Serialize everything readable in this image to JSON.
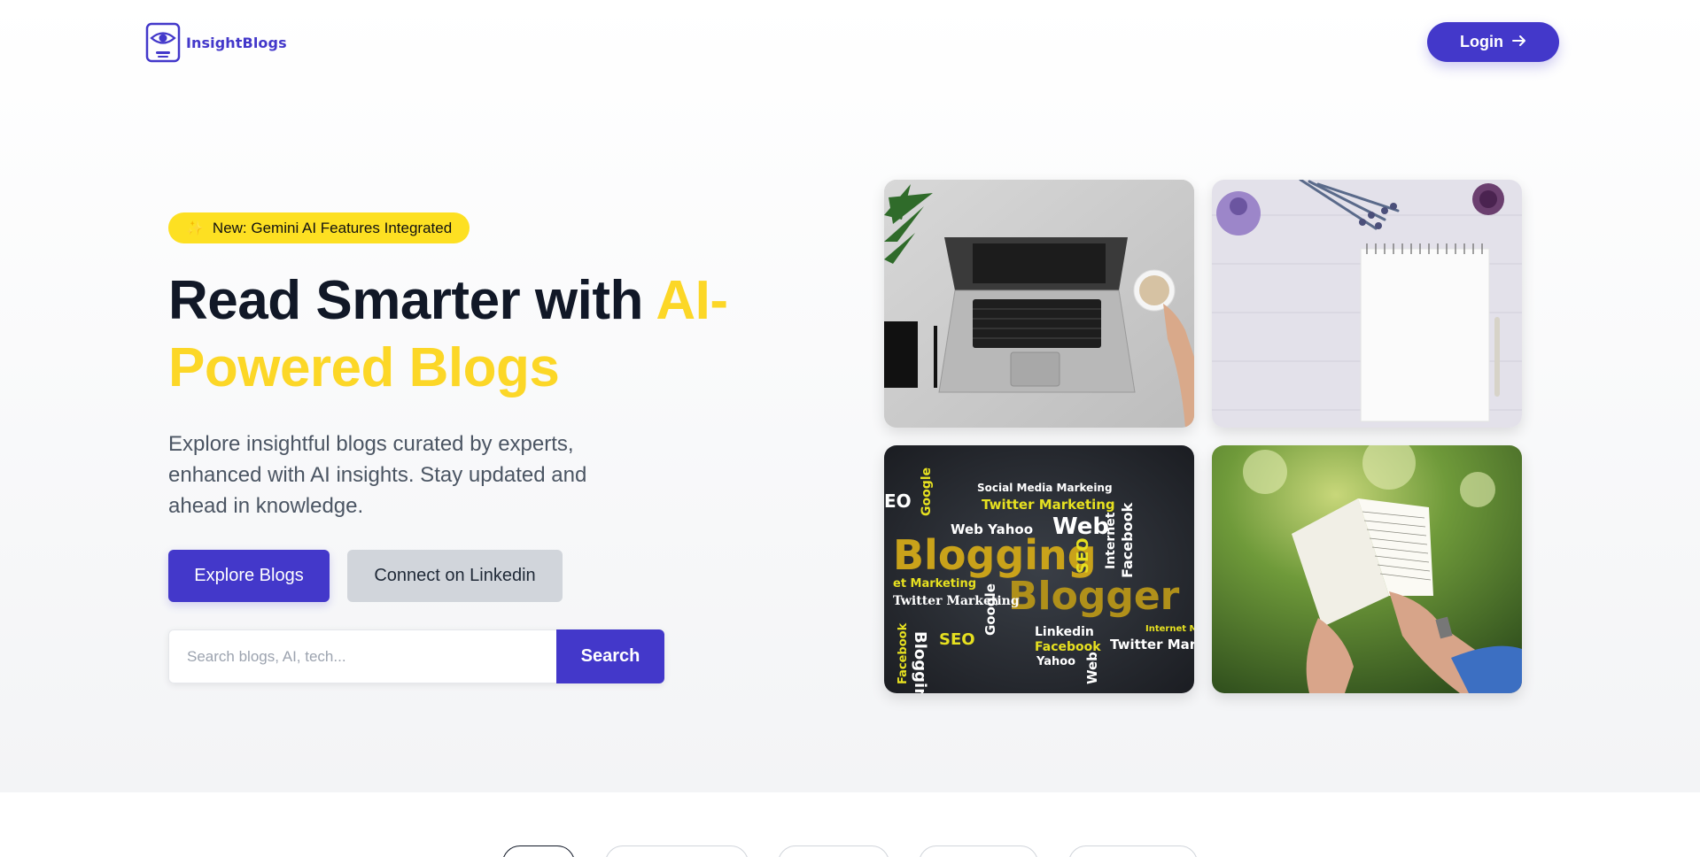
{
  "brand": {
    "name": "InsightBlogs",
    "logo_icon": "eye-book-icon"
  },
  "nav": {
    "login_label": "Login",
    "login_icon": "arrow-right-icon"
  },
  "hero": {
    "badge_icon": "sparkles-icon",
    "badge_text": "New: Gemini AI Features Integrated",
    "headline_part1": "Read Smarter with ",
    "headline_accent": "AI-Powered Blogs",
    "description": "Explore insightful blogs curated by experts, enhanced with AI insights. Stay updated and ahead in knowledge.",
    "primary_cta": "Explore Blogs",
    "secondary_cta": "Connect on Linkedin",
    "search_placeholder": "Search blogs, AI, tech...",
    "search_button": "Search"
  },
  "images": [
    {
      "name": "laptop-coffee-image"
    },
    {
      "name": "notepad-lavender-image"
    },
    {
      "name": "blogging-word-cloud-image"
    },
    {
      "name": "reading-book-grass-image"
    }
  ],
  "word_cloud": {
    "words": [
      "Social Media Markeing",
      "Twitter Marketing",
      "Web",
      "Web Yahoo",
      "Blogging",
      "Blogger",
      "SEO",
      "Google",
      "Linkedin",
      "Facebook",
      "Yahoo",
      "Internet",
      "Twitter Marketing",
      "et Marketing",
      "Twitter Mark",
      "Internet Ma"
    ]
  },
  "colors": {
    "primary": "#4338ca",
    "accent_yellow": "#fcd727",
    "badge_bg": "#fde022"
  }
}
